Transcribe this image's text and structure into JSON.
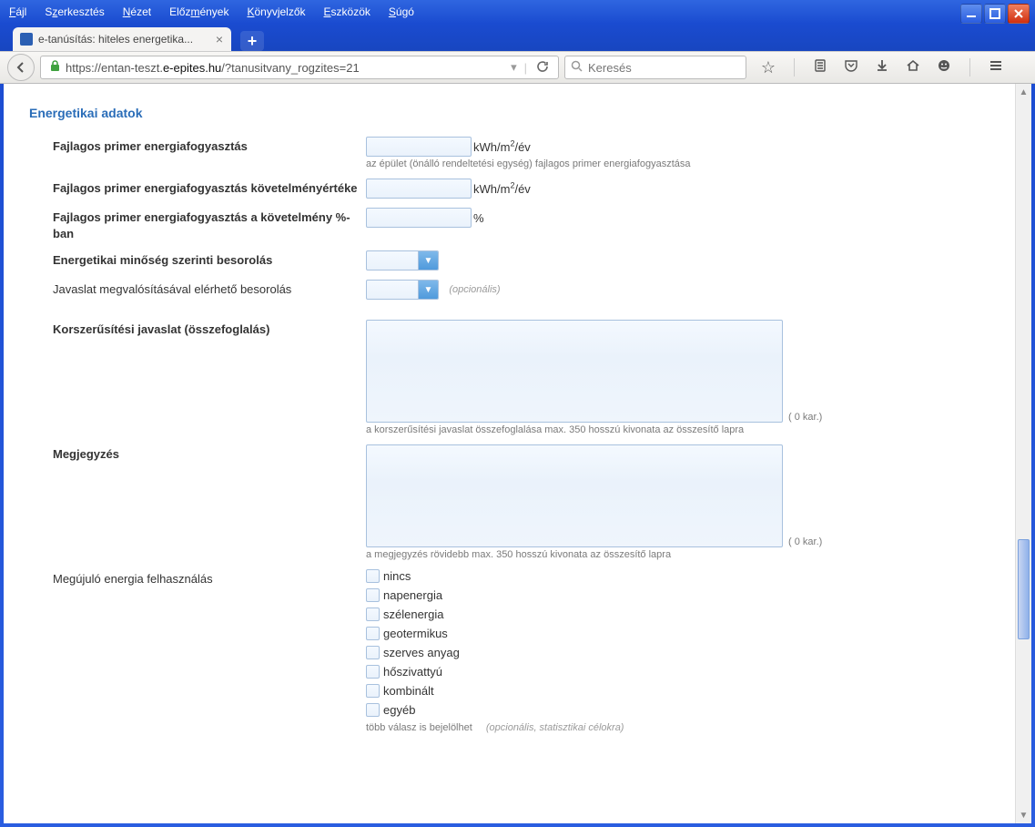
{
  "window": {
    "menus": [
      "Fájl",
      "Szerkesztés",
      "Nézet",
      "Előzmények",
      "Könyvjelzők",
      "Eszközök",
      "Súgó"
    ]
  },
  "tab": {
    "title": "e-tanúsítás: hiteles energetika..."
  },
  "nav": {
    "url_prefix": "https://entan-teszt.",
    "url_domain": "e-epites.hu",
    "url_path": "/?tanusitvany_rogzites=21",
    "search_placeholder": "Keresés"
  },
  "section": {
    "title": "Energetikai adatok"
  },
  "fields": {
    "primer": {
      "label": "Fajlagos primer energiafogyasztás",
      "unit": "kWh/m²/év",
      "hint": "az épület (önálló rendeltetési egység) fajlagos primer energiafogyasztása"
    },
    "kovetelm": {
      "label": "Fajlagos primer energiafogyasztás követelményértéke",
      "unit": "kWh/m²/év"
    },
    "percent": {
      "label": "Fajlagos primer energiafogyasztás a követelmény %-ban",
      "unit": "%"
    },
    "besorolas": {
      "label": "Energetikai minőség szerinti besorolás"
    },
    "javaslat_besorolas": {
      "label": "Javaslat megvalósításával elérhető besorolás",
      "optional": "(opcionális)"
    },
    "javaslat": {
      "label": "Korszerűsítési javaslat (összefoglalás)",
      "hint": "a korszerűsítési javaslat összefoglalása max. 350 hosszú kivonata az összesítő lapra",
      "count": "( 0 kar.)"
    },
    "megjegyzes": {
      "label": "Megjegyzés",
      "hint": "a megjegyzés rövidebb max. 350 hosszú kivonata az összesítő lapra",
      "count": "( 0 kar.)"
    },
    "megujulo": {
      "label": "Megújuló energia felhasználás",
      "options": [
        "nincs",
        "napenergia",
        "szélenergia",
        "geotermikus",
        "szerves anyag",
        "hőszivattyú",
        "kombinált",
        "egyéb"
      ],
      "hint": "több válasz is bejelölhet",
      "optional": "(opcionális, statisztikai célokra)"
    }
  }
}
